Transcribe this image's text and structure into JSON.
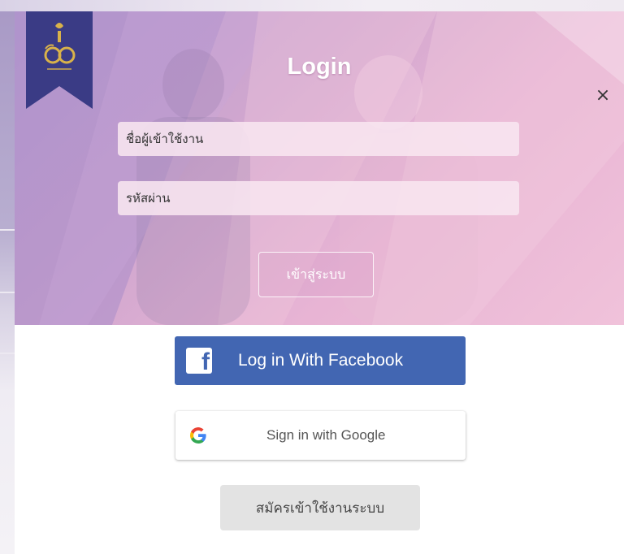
{
  "modal": {
    "title": "Login",
    "close_label": "×",
    "username_placeholder": "ชื่อผู้เข้าใช้งาน",
    "password_placeholder": "รหัสผ่าน",
    "submit_label": "เข้าสู่ระบบ"
  },
  "social": {
    "facebook_label": "Log in With Facebook",
    "facebook_icon": "facebook-icon",
    "google_label": "Sign in with Google",
    "google_icon": "google-icon"
  },
  "register_label": "สมัครเข้าใช้งานระบบ",
  "colors": {
    "facebook": "#4266b2",
    "ribbon": "#3a3b85",
    "hero_pink": "#e8b4d4",
    "hero_purple": "#b79dd0"
  }
}
